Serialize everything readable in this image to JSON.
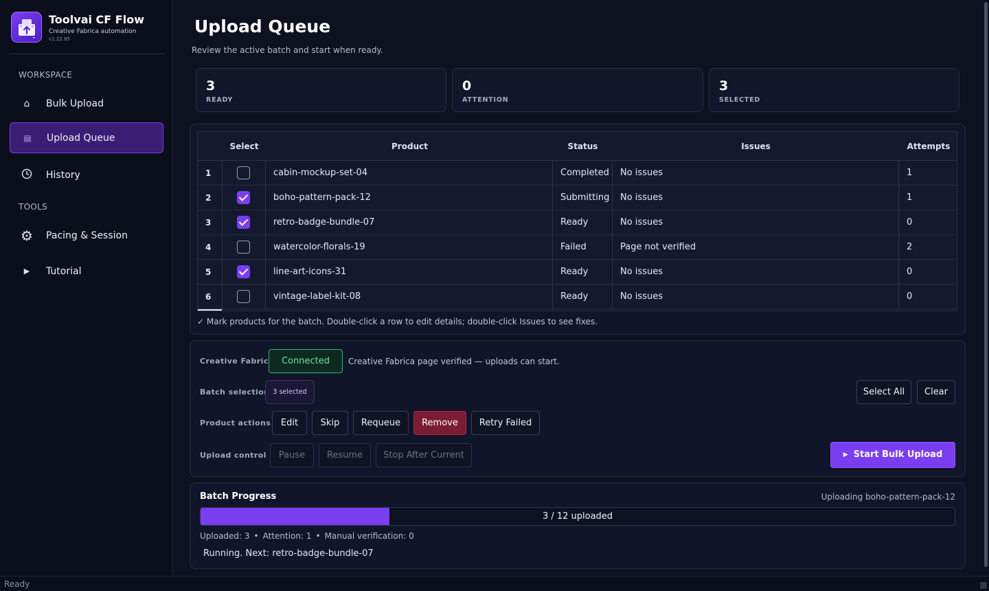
{
  "app": {
    "title": "Toolvai CF Flow",
    "subtitle": "Creative Fabrica automation",
    "version": "v1.22.85"
  },
  "sidebar": {
    "workspace_label": "WORKSPACE",
    "tools_label": "TOOLS",
    "items": [
      {
        "label": "Bulk Upload",
        "icon": "home-icon",
        "active": false
      },
      {
        "label": "Upload Queue",
        "icon": "list-icon",
        "active": true
      },
      {
        "label": "History",
        "icon": "clock-icon",
        "active": false
      },
      {
        "label": "Pacing & Session",
        "icon": "gear-icon",
        "active": false
      },
      {
        "label": "Tutorial",
        "icon": "play-icon",
        "active": false
      }
    ]
  },
  "page": {
    "title": "Upload Queue",
    "subtitle": "Review the active batch and start when ready."
  },
  "stats": [
    {
      "value": "3",
      "label": "READY"
    },
    {
      "value": "0",
      "label": "ATTENTION"
    },
    {
      "value": "3",
      "label": "SELECTED"
    }
  ],
  "table": {
    "headers": {
      "select": "Select",
      "product": "Product",
      "status": "Status",
      "issues": "Issues",
      "attempts": "Attempts"
    },
    "rows": [
      {
        "num": "1",
        "selected": false,
        "product": "cabin-mockup-set-04",
        "status": "Completed",
        "issues": "No issues",
        "attempts": "1"
      },
      {
        "num": "2",
        "selected": true,
        "product": "boho-pattern-pack-12",
        "status": "Submitting",
        "issues": "No issues",
        "attempts": "1"
      },
      {
        "num": "3",
        "selected": true,
        "product": "retro-badge-bundle-07",
        "status": "Ready",
        "issues": "No issues",
        "attempts": "0"
      },
      {
        "num": "4",
        "selected": false,
        "product": "watercolor-florals-19",
        "status": "Failed",
        "issues": "Page not verified",
        "attempts": "2"
      },
      {
        "num": "5",
        "selected": true,
        "product": "line-art-icons-31",
        "status": "Ready",
        "issues": "No issues",
        "attempts": "0"
      },
      {
        "num": "6",
        "selected": false,
        "product": "vintage-label-kit-08",
        "status": "Ready",
        "issues": "No issues",
        "attempts": "0"
      }
    ],
    "hint": "✓ Mark products for the batch. Double-click a row to edit details; double-click Issues to see fixes."
  },
  "controls": {
    "cf_label": "Creative Fabrica",
    "cf_status": "Connected",
    "cf_note": "Creative Fabrica page verified — uploads can start.",
    "batch_label": "Batch selection",
    "batch_badge": "3 selected",
    "select_all": "Select All",
    "clear": "Clear",
    "actions_label": "Product actions",
    "edit": "Edit",
    "skip": "Skip",
    "requeue": "Requeue",
    "remove": "Remove",
    "retry_failed": "Retry Failed",
    "upload_label": "Upload control",
    "pause": "Pause",
    "resume": "Resume",
    "stop_after": "Stop After Current",
    "start": "Start Bulk Upload",
    "colors": {
      "accent": "#7b3df0",
      "danger": "#7a1c34",
      "success": "#2fb86d"
    }
  },
  "progress": {
    "title": "Batch Progress",
    "current": "Uploading boho-pattern-pack-12",
    "uploaded": 3,
    "total": 12,
    "fill_fraction": 0.25,
    "bar_text": "3 / 12 uploaded",
    "stat_uploaded": "Uploaded: 3",
    "stat_attention": "Attention: 1",
    "stat_manual": "Manual verification: 0",
    "status": "Running. Next: retro-badge-bundle-07"
  },
  "statusbar": {
    "text": "Ready"
  }
}
